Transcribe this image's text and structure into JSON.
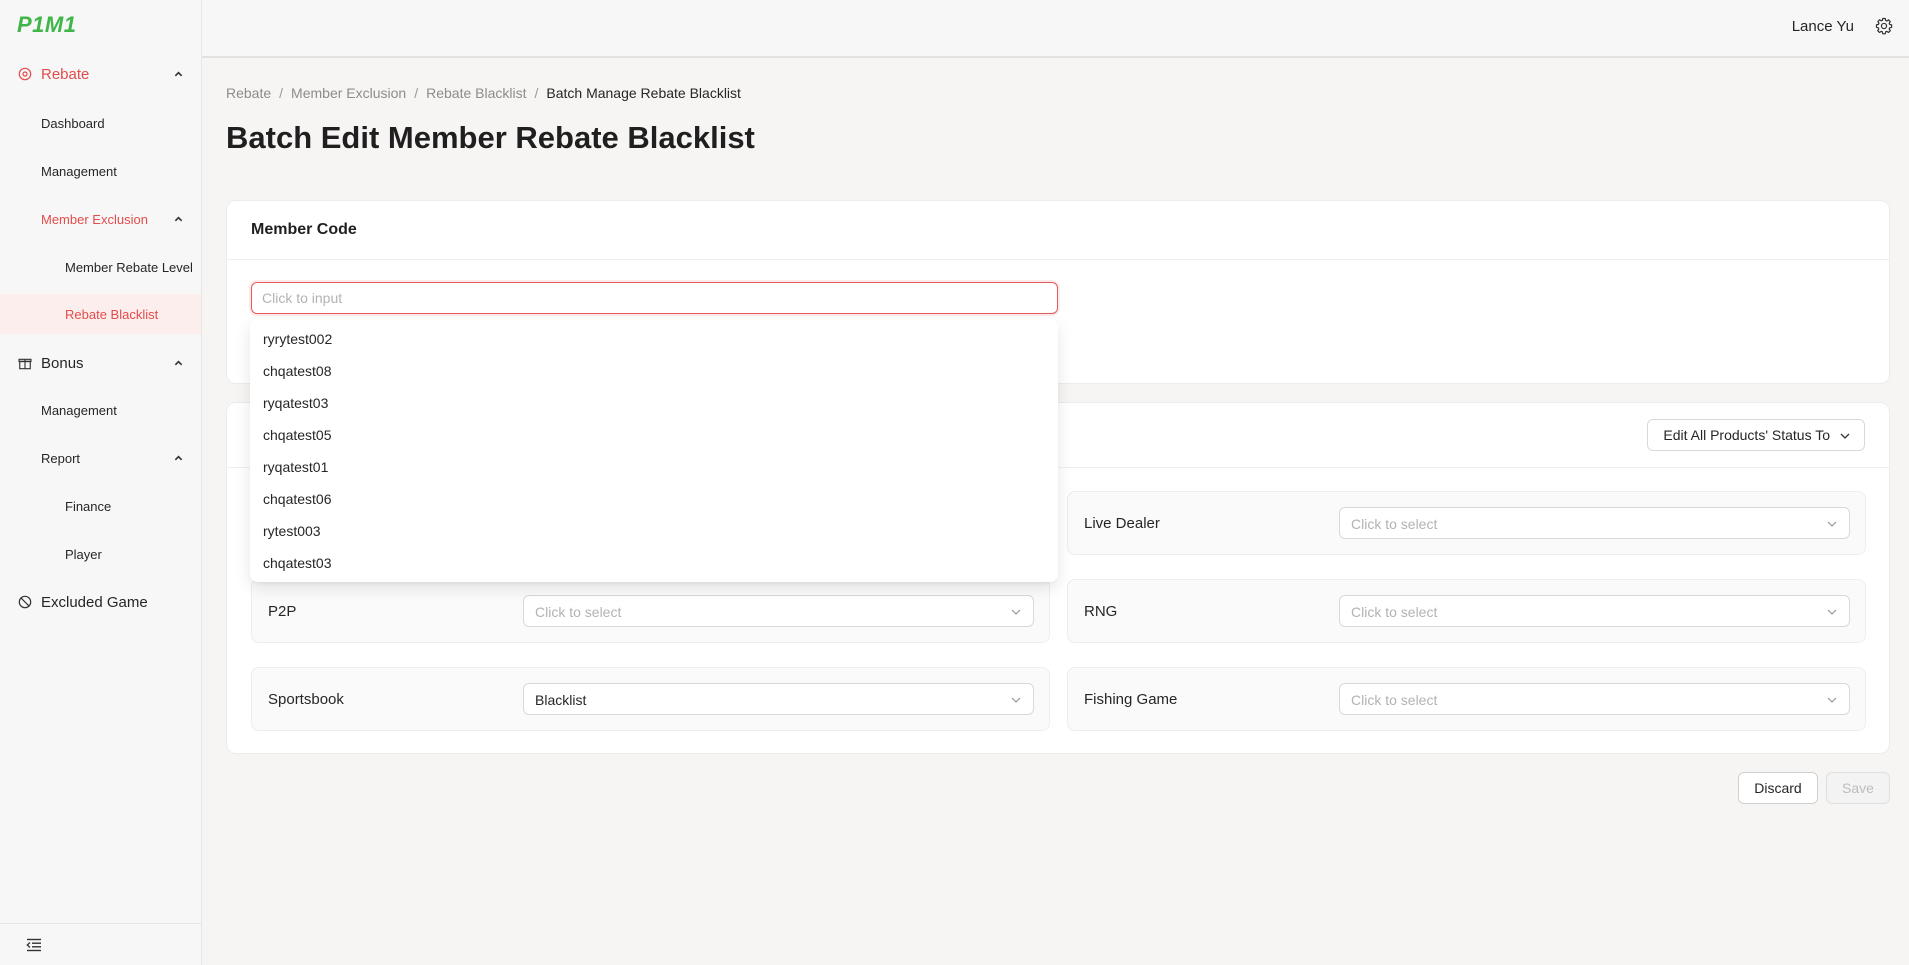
{
  "app": {
    "logo": "P1M1"
  },
  "sidebar": {
    "rebate": {
      "label": "Rebate"
    },
    "rebate_dashboard": {
      "label": "Dashboard"
    },
    "rebate_management": {
      "label": "Management"
    },
    "member_exclusion": {
      "label": "Member Exclusion"
    },
    "member_rebate_level": {
      "label": "Member Rebate Level"
    },
    "rebate_blacklist": {
      "label": "Rebate Blacklist"
    },
    "bonus": {
      "label": "Bonus"
    },
    "bonus_management": {
      "label": "Management"
    },
    "report": {
      "label": "Report"
    },
    "finance": {
      "label": "Finance"
    },
    "player": {
      "label": "Player"
    },
    "excluded_game": {
      "label": "Excluded Game"
    }
  },
  "header": {
    "user_name": "Lance Yu"
  },
  "breadcrumb": [
    "Rebate",
    "Member Exclusion",
    "Rebate Blacklist",
    "Batch Manage Rebate Blacklist"
  ],
  "page_title": "Batch Edit Member Rebate Blacklist",
  "member_code": {
    "title": "Member Code",
    "placeholder": "Click to input",
    "suggestions": [
      "ryrytest002",
      "chqatest08",
      "ryqatest03",
      "chqatest05",
      "ryqatest01",
      "chqatest06",
      "rytest003",
      "chqatest03"
    ]
  },
  "products": {
    "edit_all_label": "Edit All Products' Status To",
    "items": [
      {
        "name": "Live Dealer",
        "value": "Click to select",
        "is_placeholder": true
      },
      {
        "name": "P2P",
        "value": "Click to select",
        "is_placeholder": true
      },
      {
        "name": "RNG",
        "value": "Click to select",
        "is_placeholder": true
      },
      {
        "name": "Sportsbook",
        "value": "Blacklist",
        "is_placeholder": false
      },
      {
        "name": "Fishing Game",
        "value": "Click to select",
        "is_placeholder": true
      }
    ]
  },
  "actions": {
    "discard": "Discard",
    "save": "Save"
  },
  "colors": {
    "accent": "#e34c4c",
    "brand": "#3fb54a"
  }
}
